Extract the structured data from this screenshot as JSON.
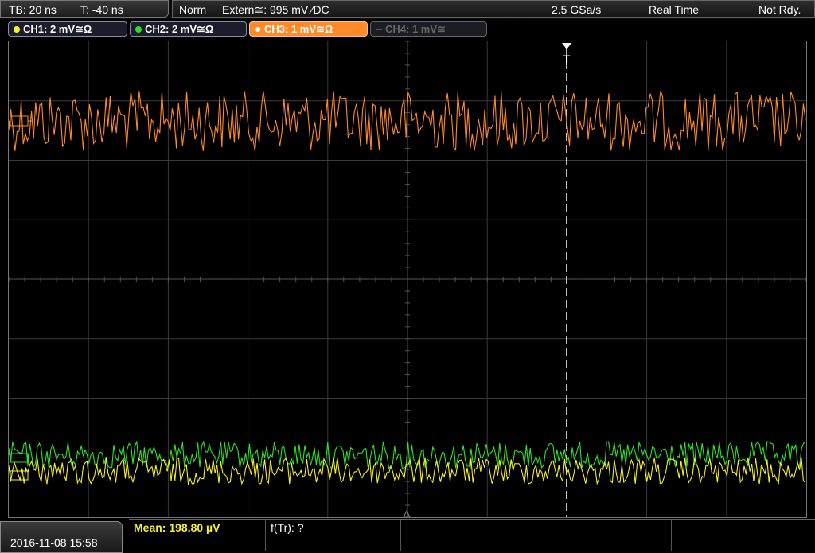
{
  "timebase": {
    "tb": "TB: 20 ns",
    "t": "T: -40 ns"
  },
  "status": {
    "mode": "Norm",
    "trigger": "Extern≅: 995 mV ∕DC",
    "sample_rate": "2.5 GSa/s",
    "acquire": "Real Time",
    "ready": "Not Rdy."
  },
  "channels": [
    {
      "label": "CH1: 2 mV≅Ω",
      "color": "#f5f02a"
    },
    {
      "label": "CH2: 2 mV≅Ω",
      "color": "#2ee02e"
    },
    {
      "label": "CH3: 1 mV≅Ω",
      "color": "#ff8a2a"
    },
    {
      "label": "CH4: 1 mV≅",
      "color": "#666666"
    }
  ],
  "markers": {
    "trigger": "T"
  },
  "measurements": {
    "mean": "Mean: 198.80 µV",
    "freq": "f(Tr): ?"
  },
  "datetime": "2016-11-08 15:58"
}
